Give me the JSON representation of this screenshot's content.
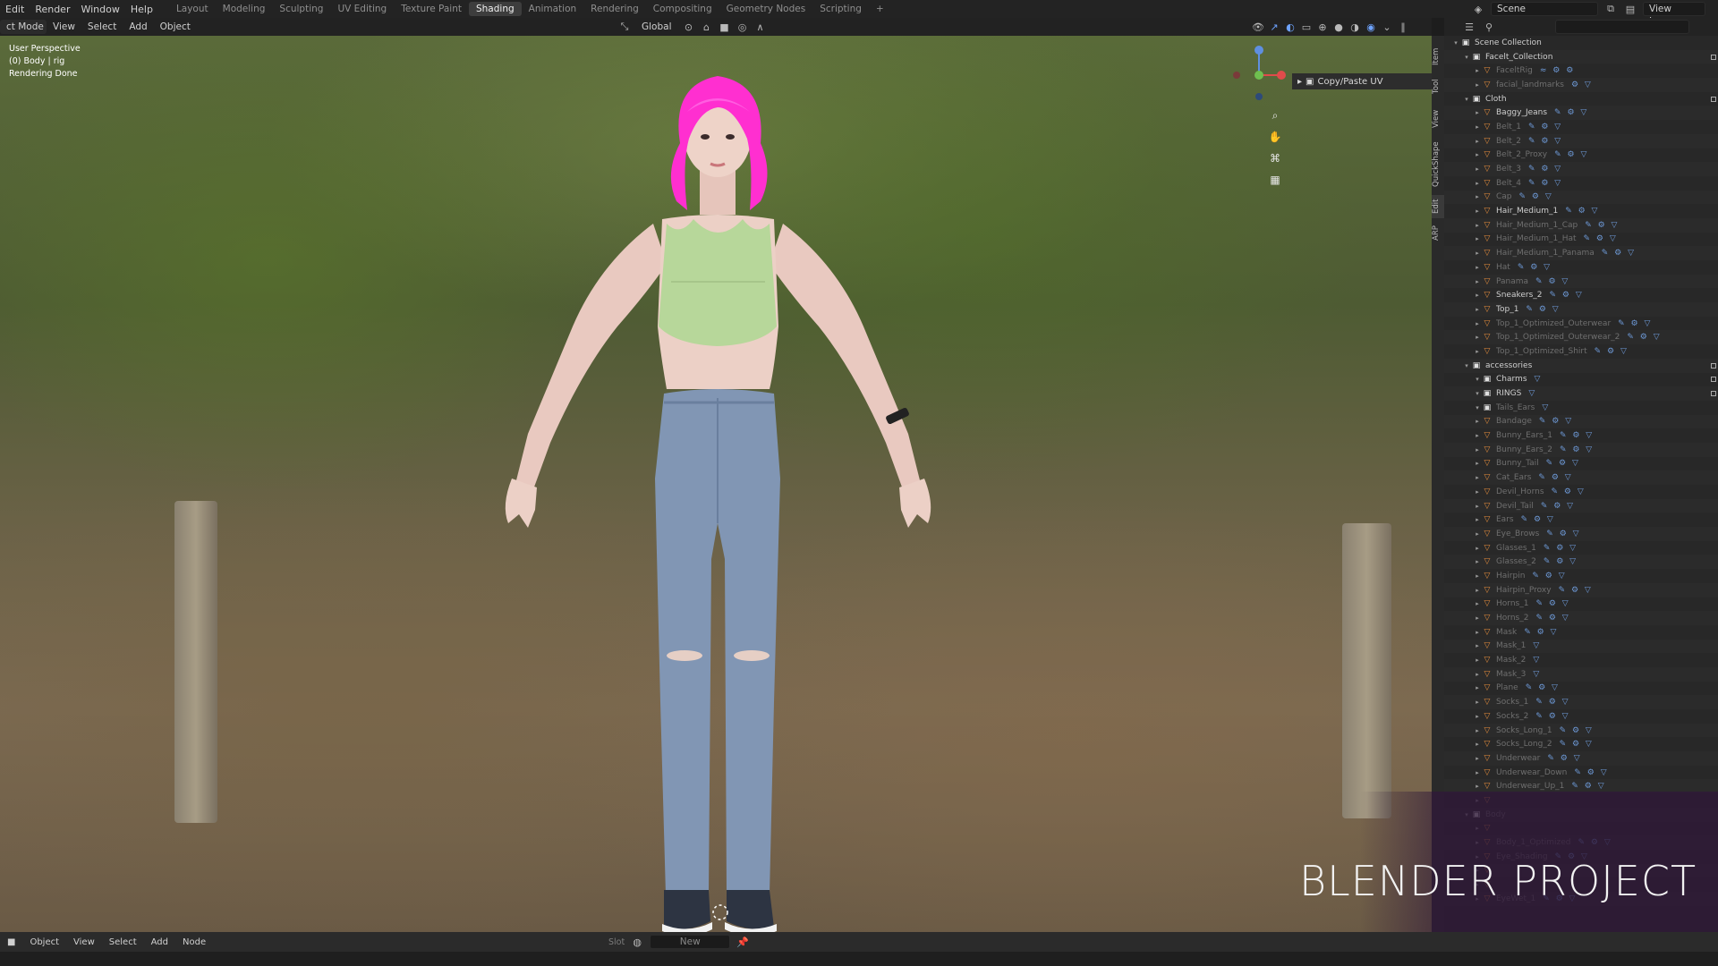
{
  "topbar": {
    "menu": [
      "Edit",
      "Render",
      "Window",
      "Help"
    ],
    "workspaces": [
      "Layout",
      "Modeling",
      "Sculpting",
      "UV Editing",
      "Texture Paint",
      "Shading",
      "Animation",
      "Rendering",
      "Compositing",
      "Geometry Nodes",
      "Scripting"
    ],
    "active_workspace": "Shading",
    "add_workspace": "+",
    "scene": "Scene",
    "view_layer": "View Layer"
  },
  "viewport_header": {
    "mode": "ct Mode",
    "menu": [
      "View",
      "Select",
      "Add",
      "Object"
    ],
    "orientation": "Global",
    "panel_title": "Copy/Paste UV"
  },
  "viewport": {
    "view_name": "User Perspective",
    "object_line": "(0) Body | rig",
    "status": "Rendering Done"
  },
  "side_tabs": [
    "Item",
    "Tool",
    "View",
    "QuickShape",
    "Edit",
    "ARP"
  ],
  "outliner": {
    "rows": [
      {
        "label": "Scene Collection",
        "depth": 0,
        "type": "coll",
        "open": true,
        "dim": false,
        "tags": ""
      },
      {
        "label": "Facelt_Collection",
        "depth": 1,
        "type": "coll",
        "open": true,
        "dim": false,
        "tags": ""
      },
      {
        "label": "FaceltRig",
        "depth": 2,
        "type": "obj",
        "dim": true,
        "tags": "≈ ⚙ ⚙"
      },
      {
        "label": "facial_landmarks",
        "depth": 2,
        "type": "obj",
        "dim": true,
        "tags": "⚙ ▽"
      },
      {
        "label": "Cloth",
        "depth": 1,
        "type": "coll",
        "open": true,
        "dim": false,
        "tags": ""
      },
      {
        "label": "Baggy_Jeans",
        "depth": 2,
        "type": "obj",
        "dim": false,
        "tags": "✎ ⚙ ▽"
      },
      {
        "label": "Belt_1",
        "depth": 2,
        "type": "obj",
        "dim": true,
        "tags": "✎ ⚙ ▽"
      },
      {
        "label": "Belt_2",
        "depth": 2,
        "type": "obj",
        "dim": true,
        "tags": "✎ ⚙ ▽"
      },
      {
        "label": "Belt_2_Proxy",
        "depth": 2,
        "type": "obj",
        "dim": true,
        "tags": "✎ ⚙ ▽"
      },
      {
        "label": "Belt_3",
        "depth": 2,
        "type": "obj",
        "dim": true,
        "tags": "✎ ⚙ ▽"
      },
      {
        "label": "Belt_4",
        "depth": 2,
        "type": "obj",
        "dim": true,
        "tags": "✎ ⚙ ▽"
      },
      {
        "label": "Cap",
        "depth": 2,
        "type": "obj",
        "dim": true,
        "tags": "✎ ⚙ ▽"
      },
      {
        "label": "Hair_Medium_1",
        "depth": 2,
        "type": "obj",
        "dim": false,
        "tags": "✎ ⚙ ▽"
      },
      {
        "label": "Hair_Medium_1_Cap",
        "depth": 2,
        "type": "obj",
        "dim": true,
        "tags": "✎ ⚙ ▽"
      },
      {
        "label": "Hair_Medium_1_Hat",
        "depth": 2,
        "type": "obj",
        "dim": true,
        "tags": "✎ ⚙ ▽"
      },
      {
        "label": "Hair_Medium_1_Panama",
        "depth": 2,
        "type": "obj",
        "dim": true,
        "tags": "✎ ⚙ ▽"
      },
      {
        "label": "Hat",
        "depth": 2,
        "type": "obj",
        "dim": true,
        "tags": "✎ ⚙ ▽"
      },
      {
        "label": "Panama",
        "depth": 2,
        "type": "obj",
        "dim": true,
        "tags": "✎ ⚙ ▽"
      },
      {
        "label": "Sneakers_2",
        "depth": 2,
        "type": "obj",
        "dim": false,
        "tags": "✎ ⚙ ▽"
      },
      {
        "label": "Top_1",
        "depth": 2,
        "type": "obj",
        "dim": false,
        "tags": "✎ ⚙ ▽"
      },
      {
        "label": "Top_1_Optimized_Outerwear",
        "depth": 2,
        "type": "obj",
        "dim": true,
        "tags": "✎ ⚙ ▽"
      },
      {
        "label": "Top_1_Optimized_Outerwear_2",
        "depth": 2,
        "type": "obj",
        "dim": true,
        "tags": "✎ ⚙ ▽"
      },
      {
        "label": "Top_1_Optimized_Shirt",
        "depth": 2,
        "type": "obj",
        "dim": true,
        "tags": "✎ ⚙ ▽"
      },
      {
        "label": "accessories",
        "depth": 1,
        "type": "coll",
        "open": true,
        "dim": false,
        "tags": ""
      },
      {
        "label": "Charms",
        "depth": 2,
        "type": "coll",
        "dim": false,
        "tags": "▽"
      },
      {
        "label": "RINGS",
        "depth": 2,
        "type": "coll",
        "dim": false,
        "tags": "▽"
      },
      {
        "label": "Tails_Ears",
        "depth": 2,
        "type": "coll",
        "dim": true,
        "tags": "▽"
      },
      {
        "label": "Bandage",
        "depth": 2,
        "type": "obj",
        "dim": true,
        "tags": "✎ ⚙ ▽"
      },
      {
        "label": "Bunny_Ears_1",
        "depth": 2,
        "type": "obj",
        "dim": true,
        "tags": "✎ ⚙ ▽"
      },
      {
        "label": "Bunny_Ears_2",
        "depth": 2,
        "type": "obj",
        "dim": true,
        "tags": "✎ ⚙ ▽"
      },
      {
        "label": "Bunny_Tail",
        "depth": 2,
        "type": "obj",
        "dim": true,
        "tags": "✎ ⚙ ▽"
      },
      {
        "label": "Cat_Ears",
        "depth": 2,
        "type": "obj",
        "dim": true,
        "tags": "✎ ⚙ ▽"
      },
      {
        "label": "Devil_Horns",
        "depth": 2,
        "type": "obj",
        "dim": true,
        "tags": "✎ ⚙ ▽"
      },
      {
        "label": "Devil_Tail",
        "depth": 2,
        "type": "obj",
        "dim": true,
        "tags": "✎ ⚙ ▽"
      },
      {
        "label": "Ears",
        "depth": 2,
        "type": "obj",
        "dim": true,
        "tags": "✎ ⚙ ▽"
      },
      {
        "label": "Eye_Brows",
        "depth": 2,
        "type": "obj",
        "dim": true,
        "tags": "✎ ⚙ ▽"
      },
      {
        "label": "Glasses_1",
        "depth": 2,
        "type": "obj",
        "dim": true,
        "tags": "✎ ⚙ ▽"
      },
      {
        "label": "Glasses_2",
        "depth": 2,
        "type": "obj",
        "dim": true,
        "tags": "✎ ⚙ ▽"
      },
      {
        "label": "Hairpin",
        "depth": 2,
        "type": "obj",
        "dim": true,
        "tags": "✎ ⚙ ▽"
      },
      {
        "label": "Hairpin_Proxy",
        "depth": 2,
        "type": "obj",
        "dim": true,
        "tags": "✎ ⚙ ▽"
      },
      {
        "label": "Horns_1",
        "depth": 2,
        "type": "obj",
        "dim": true,
        "tags": "✎ ⚙ ▽"
      },
      {
        "label": "Horns_2",
        "depth": 2,
        "type": "obj",
        "dim": true,
        "tags": "✎ ⚙ ▽"
      },
      {
        "label": "Mask",
        "depth": 2,
        "type": "obj",
        "dim": true,
        "tags": "✎ ⚙ ▽"
      },
      {
        "label": "Mask_1",
        "depth": 2,
        "type": "obj",
        "dim": true,
        "tags": "▽"
      },
      {
        "label": "Mask_2",
        "depth": 2,
        "type": "obj",
        "dim": true,
        "tags": "▽"
      },
      {
        "label": "Mask_3",
        "depth": 2,
        "type": "obj",
        "dim": true,
        "tags": "▽"
      },
      {
        "label": "Plane",
        "depth": 2,
        "type": "obj",
        "dim": true,
        "tags": "✎ ⚙ ▽"
      },
      {
        "label": "Socks_1",
        "depth": 2,
        "type": "obj",
        "dim": true,
        "tags": "✎ ⚙ ▽"
      },
      {
        "label": "Socks_2",
        "depth": 2,
        "type": "obj",
        "dim": true,
        "tags": "✎ ⚙ ▽"
      },
      {
        "label": "Socks_Long_1",
        "depth": 2,
        "type": "obj",
        "dim": true,
        "tags": "✎ ⚙ ▽"
      },
      {
        "label": "Socks_Long_2",
        "depth": 2,
        "type": "obj",
        "dim": true,
        "tags": "✎ ⚙ ▽"
      },
      {
        "label": "Underwear",
        "depth": 2,
        "type": "obj",
        "dim": true,
        "tags": "✎ ⚙ ▽"
      },
      {
        "label": "Underwear_Down",
        "depth": 2,
        "type": "obj",
        "dim": true,
        "tags": "✎ ⚙ ▽"
      },
      {
        "label": "Underwear_Up_1",
        "depth": 2,
        "type": "obj",
        "dim": true,
        "tags": "✎ ⚙ ▽"
      },
      {
        "label": "",
        "depth": 2,
        "type": "obj",
        "dim": true,
        "tags": ""
      },
      {
        "label": "Body",
        "depth": 1,
        "type": "coll",
        "open": true,
        "dim": true,
        "tags": ""
      },
      {
        "label": "",
        "depth": 2,
        "type": "obj",
        "dim": true,
        "tags": ""
      },
      {
        "label": "Body_1_Optimized",
        "depth": 2,
        "type": "obj",
        "dim": true,
        "tags": "✎ ⚙ ▽"
      },
      {
        "label": "Eye_Shading",
        "depth": 2,
        "type": "obj",
        "dim": true,
        "tags": "✎ ⚙ ▽"
      },
      {
        "label": "",
        "depth": 2,
        "type": "obj",
        "dim": true,
        "tags": ""
      },
      {
        "label": "",
        "depth": 2,
        "type": "obj",
        "dim": true,
        "tags": ""
      },
      {
        "label": "EyeWet_1",
        "depth": 2,
        "type": "obj",
        "dim": true,
        "tags": "✎ ⚙ ▽"
      }
    ]
  },
  "bottom_bar": {
    "mode": "Object",
    "menu": [
      "View",
      "Select",
      "Add",
      "Node"
    ],
    "slot": "Slot",
    "new_button": "New"
  },
  "watermark": "BLENDER PROJECT",
  "colors": {
    "hair": "#ff2fd0",
    "top": "#b7d79a",
    "jeans": "#8196b4",
    "accent_active": "#3d3d3d",
    "object_icon": "#e08a3c"
  }
}
